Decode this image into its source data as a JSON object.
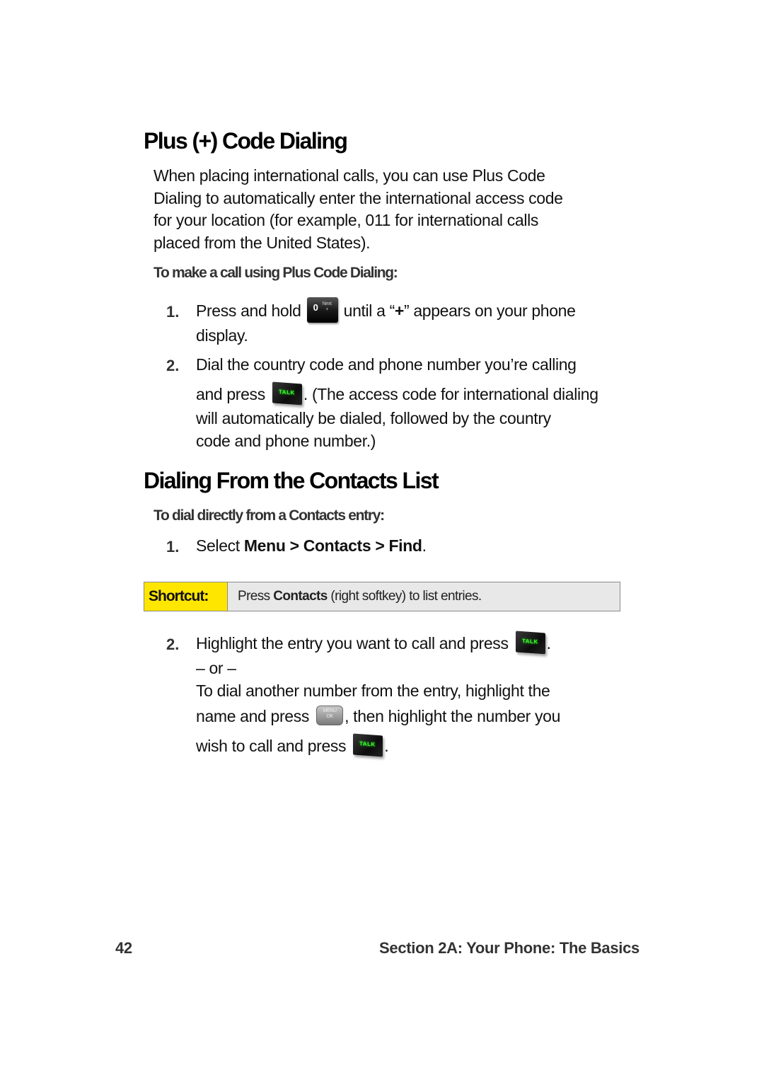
{
  "section1": {
    "title": "Plus (+) Code Dialing",
    "intro_lines": [
      "When placing international calls, you can use Plus Code",
      "Dialing to automatically enter the international access code",
      "for your location (for example, 011 for international calls",
      "placed from the United States)."
    ],
    "subheading": "To make a call using Plus Code Dialing:",
    "steps": [
      {
        "number": "1.",
        "before_key": "Press and hold",
        "key_icon": "zero-next-plus-key-icon",
        "key_label": "0",
        "key_sublabel": "Next +",
        "after_key_a": "until a “",
        "after_key_bold": "+",
        "after_key_b": "” appears on your phone",
        "line2": "display."
      },
      {
        "number": "2.",
        "line1": "Dial the country code and phone number you’re calling",
        "before_key": "and press",
        "key_icon": "talk-key-icon",
        "key_label": "TALK",
        "after_key": ". (The access code for international dialing",
        "line3": "will automatically be dialed, followed by the country",
        "line4": "code and phone number.)"
      }
    ]
  },
  "section2": {
    "title": "Dialing From the Contacts List",
    "subheading": "To dial directly from a Contacts entry:",
    "step1": {
      "number": "1.",
      "prefix": "Select ",
      "menu": "Menu",
      "sep1": " > ",
      "contacts": "Contacts",
      "sep2": " > ",
      "find": "Find",
      "suffix": "."
    },
    "shortcut": {
      "label": "Shortcut:",
      "prefix": "Press ",
      "bold": "Contacts",
      "suffix": " (right softkey) to list entries.",
      "label_color": "#ffe600",
      "box_color": "#e8e8e8"
    },
    "step2": {
      "number": "2.",
      "line1": "Highlight the entry you want to call and press",
      "line1_end": ".",
      "or": "– or –",
      "line3": "To dial another number from the entry, highlight the",
      "line4_a": "name and press",
      "menu_key_label": "MENU OK",
      "line4_b": ", then highlight the number you",
      "line5_a": "wish to call and press",
      "line5_end": ".",
      "talk_key_label": "TALK"
    }
  },
  "footer": {
    "page_number": "42",
    "section": "Section 2A: Your Phone: The Basics"
  }
}
